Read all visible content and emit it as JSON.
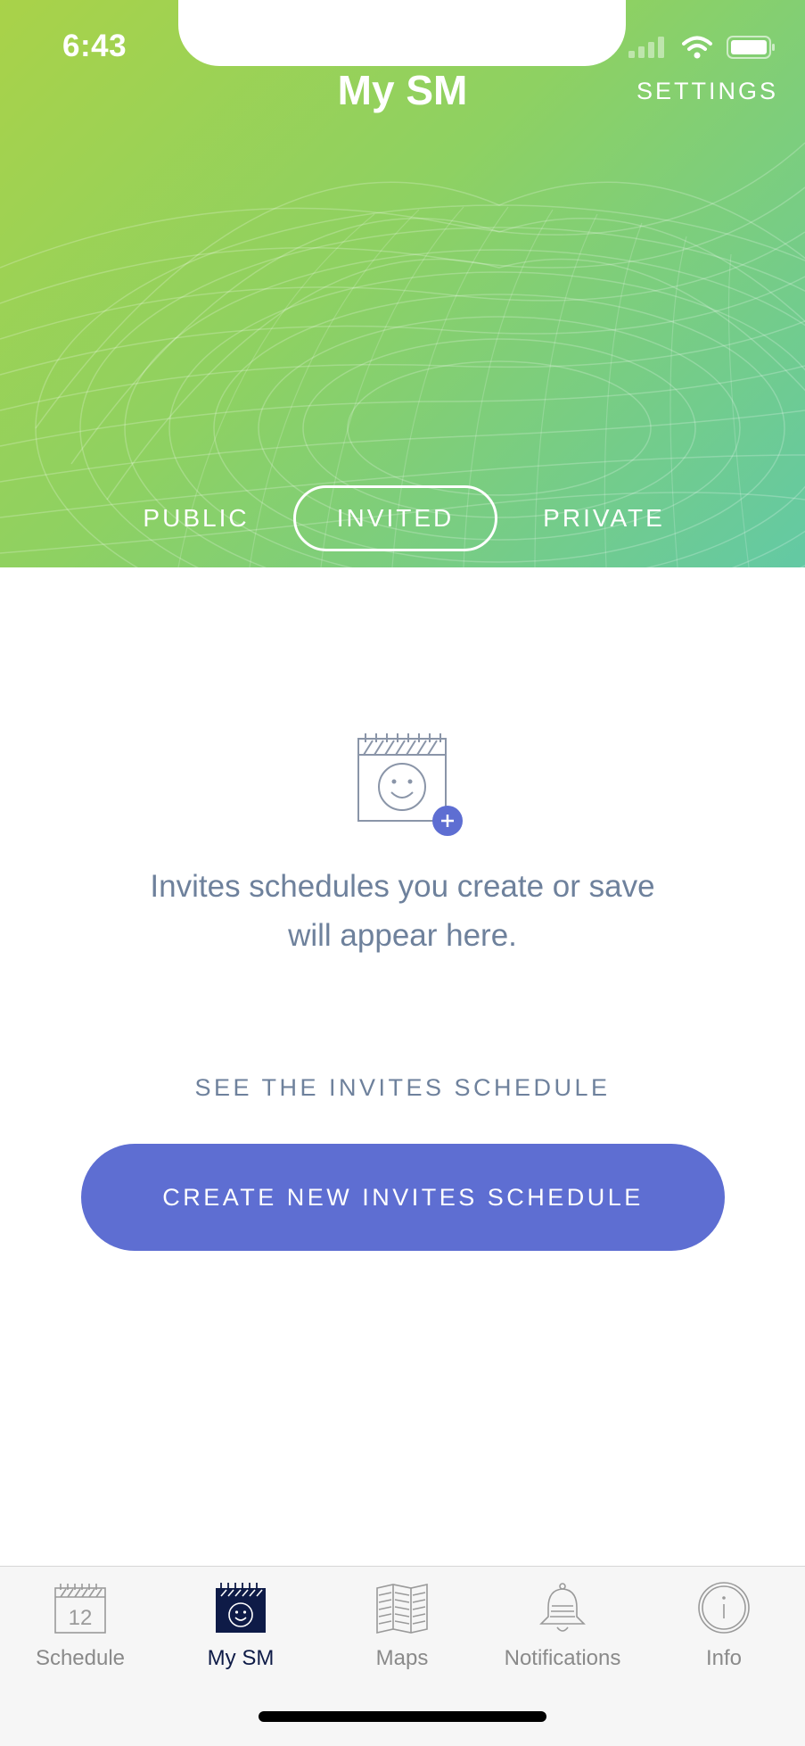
{
  "status_bar": {
    "time": "6:43"
  },
  "header": {
    "title": "My SM",
    "settings_label": "SETTINGS",
    "segments": [
      {
        "label": "PUBLIC",
        "selected": false
      },
      {
        "label": "INVITED",
        "selected": true
      },
      {
        "label": "PRIVATE",
        "selected": false
      }
    ],
    "gradient_colors": [
      "#a9d249",
      "#63c9a4"
    ]
  },
  "empty_state": {
    "icon": "calendar-smile-add-icon",
    "message_line1": "Invites schedules you create or save",
    "message_line2": "will appear here."
  },
  "actions": {
    "see_link": "SEE THE INVITES SCHEDULE",
    "create_button": "CREATE NEW INVITES SCHEDULE",
    "accent_color": "#5e6ed2"
  },
  "tabbar": {
    "tabs": [
      {
        "label": "Schedule",
        "icon": "calendar-icon",
        "badge_number": "12",
        "active": false
      },
      {
        "label": "My SM",
        "icon": "calendar-smile-icon",
        "active": true
      },
      {
        "label": "Maps",
        "icon": "map-icon",
        "active": false
      },
      {
        "label": "Notifications",
        "icon": "bell-icon",
        "active": false
      },
      {
        "label": "Info",
        "icon": "info-icon",
        "active": false
      }
    ]
  }
}
